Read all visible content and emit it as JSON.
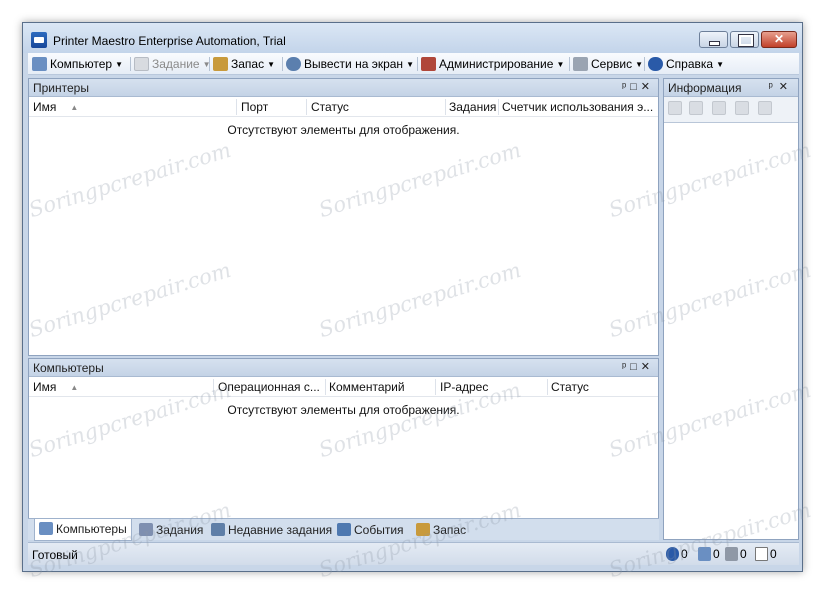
{
  "window": {
    "title": "Printer Maestro Enterprise Automation, Trial"
  },
  "menubar": {
    "items": [
      {
        "label": "Компьютер",
        "icon": "computers-icon"
      },
      {
        "label": "Задание",
        "icon": "job-icon",
        "disabled": true
      },
      {
        "label": "Запас",
        "icon": "box-icon"
      },
      {
        "label": "Вывести на экран",
        "icon": "magnifier-icon"
      },
      {
        "label": "Администрирование",
        "icon": "admin-icon"
      },
      {
        "label": "Сервис",
        "icon": "tools-icon"
      },
      {
        "label": "Справка",
        "icon": "help-icon"
      }
    ]
  },
  "printers_panel": {
    "title": "Принтеры",
    "columns": [
      "Имя",
      "Порт",
      "Статус",
      "Задания",
      "Счетчик использования э..."
    ],
    "empty_text": "Отсутствуют элементы для отображения."
  },
  "computers_panel": {
    "title": "Компьютеры",
    "columns": [
      "Имя",
      "Операционная с...",
      "Комментарий",
      "IP-адрес",
      "Статус"
    ],
    "empty_text": "Отсутствуют элементы для отображения."
  },
  "info_panel": {
    "title": "Информация"
  },
  "bottom_tabs": [
    {
      "label": "Компьютеры",
      "icon": "computers-icon"
    },
    {
      "label": "Задания",
      "icon": "jobs-icon"
    },
    {
      "label": "Недавние задания",
      "icon": "recent-jobs-icon"
    },
    {
      "label": "События",
      "icon": "events-icon"
    },
    {
      "label": "Запас",
      "icon": "box-icon"
    }
  ],
  "statusbar": {
    "text": "Готовый",
    "counters": [
      {
        "icon": "info-icon",
        "value": "0"
      },
      {
        "icon": "computer-status-icon",
        "value": "0"
      },
      {
        "icon": "printer-status-icon",
        "value": "0"
      },
      {
        "icon": "document-status-icon",
        "value": "0"
      }
    ]
  },
  "watermark": "Soringpcrepair.com",
  "colors": {
    "title_bar": "#c3d4ea",
    "panel_border": "#8fa3bf",
    "close_button": "#c1402a"
  }
}
